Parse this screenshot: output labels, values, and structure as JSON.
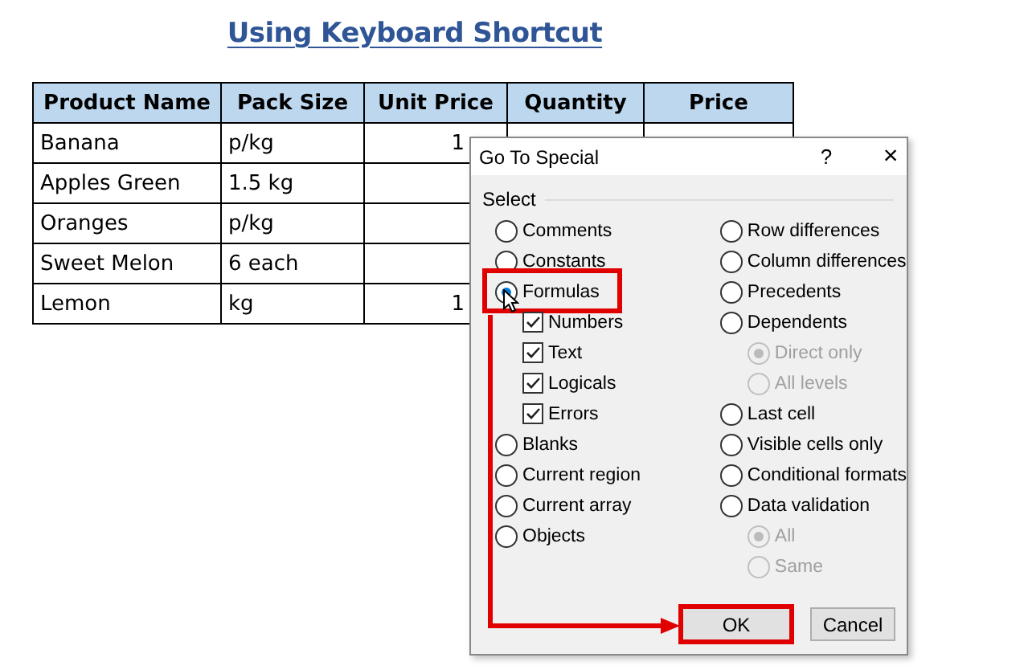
{
  "heading": "Using Keyboard Shortcut",
  "table": {
    "columns": [
      "Product Name",
      "Pack Size",
      "Unit Price",
      "Quantity",
      "Price"
    ],
    "rows": [
      [
        "Banana",
        "p/kg",
        "1"
      ],
      [
        "Apples Green",
        "1.5 kg"
      ],
      [
        "Oranges",
        "p/kg"
      ],
      [
        "Sweet Melon",
        "6 each"
      ],
      [
        "Lemon",
        "kg",
        "1"
      ]
    ]
  },
  "dialog": {
    "title": "Go To Special",
    "help_button": "?",
    "close_button": "×",
    "group_label": "Select",
    "left_options": [
      {
        "kind": "radio",
        "label": "Comments",
        "selected": false,
        "disabled": false,
        "highlighted": false
      },
      {
        "kind": "radio",
        "label": "Constants",
        "selected": false,
        "disabled": false,
        "highlighted": false
      },
      {
        "kind": "radio",
        "label": "Formulas",
        "selected": true,
        "disabled": false,
        "highlighted": true,
        "children": [
          {
            "kind": "checkbox",
            "label": "Numbers",
            "checked": true,
            "disabled": false,
            "highlighted": false
          },
          {
            "kind": "checkbox",
            "label": "Text",
            "checked": true,
            "disabled": false,
            "highlighted": false
          },
          {
            "kind": "checkbox",
            "label": "Logicals",
            "checked": true,
            "disabled": false,
            "highlighted": false
          },
          {
            "kind": "checkbox",
            "label": "Errors",
            "checked": true,
            "disabled": false,
            "highlighted": false
          }
        ]
      },
      {
        "kind": "radio",
        "label": "Blanks",
        "selected": false,
        "disabled": false,
        "highlighted": false
      },
      {
        "kind": "radio",
        "label": "Current region",
        "selected": false,
        "disabled": false,
        "highlighted": false
      },
      {
        "kind": "radio",
        "label": "Current array",
        "selected": false,
        "disabled": false,
        "highlighted": false
      },
      {
        "kind": "radio",
        "label": "Objects",
        "selected": false,
        "disabled": false,
        "highlighted": false
      }
    ],
    "right_options": [
      {
        "kind": "radio",
        "label": "Row differences",
        "selected": false,
        "disabled": false,
        "highlighted": false
      },
      {
        "kind": "radio",
        "label": "Column differences",
        "selected": false,
        "disabled": false,
        "highlighted": false
      },
      {
        "kind": "radio",
        "label": "Precedents",
        "selected": false,
        "disabled": false,
        "highlighted": false
      },
      {
        "kind": "radio",
        "label": "Dependents",
        "selected": false,
        "disabled": false,
        "highlighted": false,
        "children": [
          {
            "kind": "radio",
            "label": "Direct only",
            "selected": true,
            "disabled": true,
            "highlighted": false
          },
          {
            "kind": "radio",
            "label": "All levels",
            "selected": false,
            "disabled": true,
            "highlighted": false
          }
        ]
      },
      {
        "kind": "radio",
        "label": "Last cell",
        "selected": false,
        "disabled": false,
        "highlighted": false
      },
      {
        "kind": "radio",
        "label": "Visible cells only",
        "selected": false,
        "disabled": false,
        "highlighted": false
      },
      {
        "kind": "radio",
        "label": "Conditional formats",
        "selected": false,
        "disabled": false,
        "highlighted": false
      },
      {
        "kind": "radio",
        "label": "Data validation",
        "selected": false,
        "disabled": false,
        "highlighted": false,
        "children": [
          {
            "kind": "radio",
            "label": "All",
            "selected": true,
            "disabled": true,
            "highlighted": false
          },
          {
            "kind": "radio",
            "label": "Same",
            "selected": false,
            "disabled": true,
            "highlighted": false
          }
        ]
      }
    ],
    "buttons": [
      {
        "label": "OK",
        "highlighted": true
      },
      {
        "label": "Cancel",
        "highlighted": false
      }
    ]
  }
}
